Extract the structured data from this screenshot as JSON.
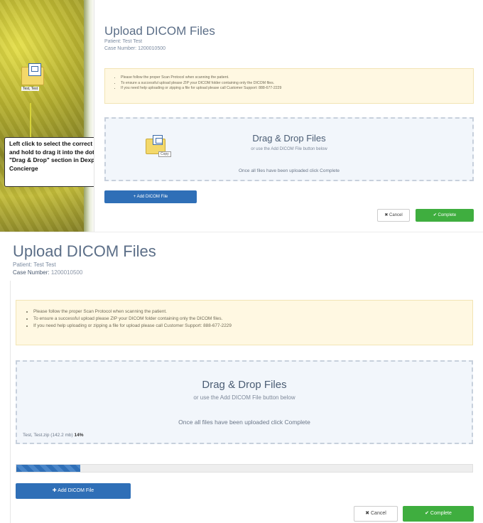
{
  "colors": {
    "accent": "#2f6fb7",
    "success": "#3fae3f",
    "alert_bg": "#fff8e2",
    "title": "#5b6e87",
    "progress": "#2f6fb7"
  },
  "desktop": {
    "folder_label": "Test, Test",
    "callout": "Left click to select the correct folder and hold to drag it into the dotted \"Drag & Drop\" section in Dexplant Concierge",
    "drag_label": "Copy"
  },
  "top": {
    "title": "Upload DICOM Files",
    "patient": "Patient: Test Test",
    "case": "Case Number: 1200010500",
    "alerts": [
      "Please follow the proper Scan Protocol when scanning the patient.",
      "To ensure a successful upload please ZIP your DICOM folder containing only the DICOM files.",
      "If you need help uploading or zipping a file for upload please call Customer Support: 888-677-2229"
    ],
    "drop_title": "Drag & Drop Files",
    "drop_sub": "or use the Add DICOM File button below",
    "drop_note": "Once all files have been uploaded click Complete",
    "add_label": "+ Add DICOM File",
    "cancel_label": "✖ Cancel",
    "complete_label": "✔ Complete"
  },
  "bottom": {
    "title": "Upload DICOM Files",
    "patient": "Patient: Test Test",
    "case_label": "Case Number:",
    "case_value": "1200010500",
    "alerts": [
      "Please follow the proper Scan Protocol when scanning the patient.",
      "To ensure a successful upload please ZIP your DICOM folder containing only the DICOM files.",
      "If you need help uploading or zipping a file for upload please call Customer Support: 888-677-2229"
    ],
    "drop_title": "Drag & Drop Files",
    "drop_sub": "or use the Add DICOM File button below",
    "drop_note": "Once all files have been uploaded click Complete",
    "file_name": "Test, Test.zip (142.2 mb)",
    "file_pct": "14%",
    "progress_fraction": 0.14,
    "add_label": "✚ Add DICOM File",
    "cancel_label": "✖ Cancel",
    "complete_label": "✔ Complete"
  }
}
